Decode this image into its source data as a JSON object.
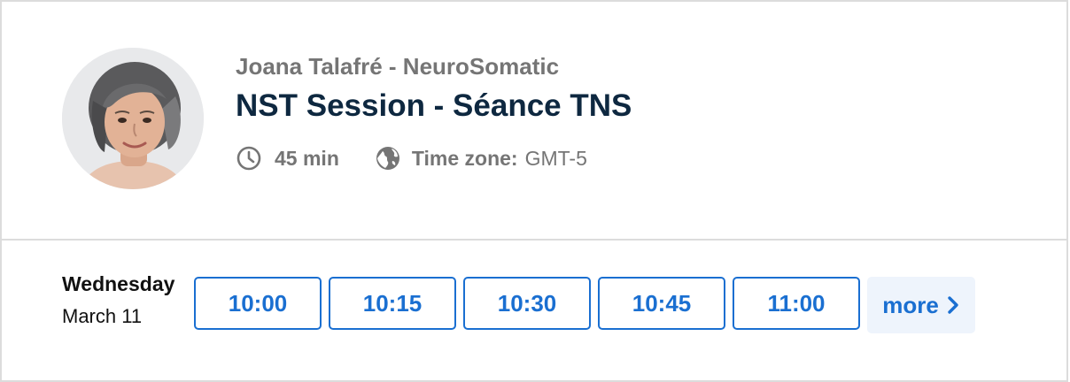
{
  "event": {
    "host": "Joana Talafré - NeuroSomatic",
    "title": "NST Session - Séance TNS",
    "duration": "45 min",
    "timezone_label": "Time zone:",
    "timezone_value": "GMT-5"
  },
  "schedule": {
    "weekday": "Wednesday",
    "date": "March 11",
    "slots": [
      "10:00",
      "10:15",
      "10:30",
      "10:45",
      "11:00"
    ],
    "more_label": "more"
  },
  "icons": {
    "duration": "clock-icon",
    "timezone": "globe-icon",
    "more": "chevron-right-icon"
  },
  "colors": {
    "accent": "#1a6fd1",
    "title": "#0e2840",
    "muted": "#757575",
    "border": "#dcdcdc",
    "more_bg": "#eef4fc"
  }
}
